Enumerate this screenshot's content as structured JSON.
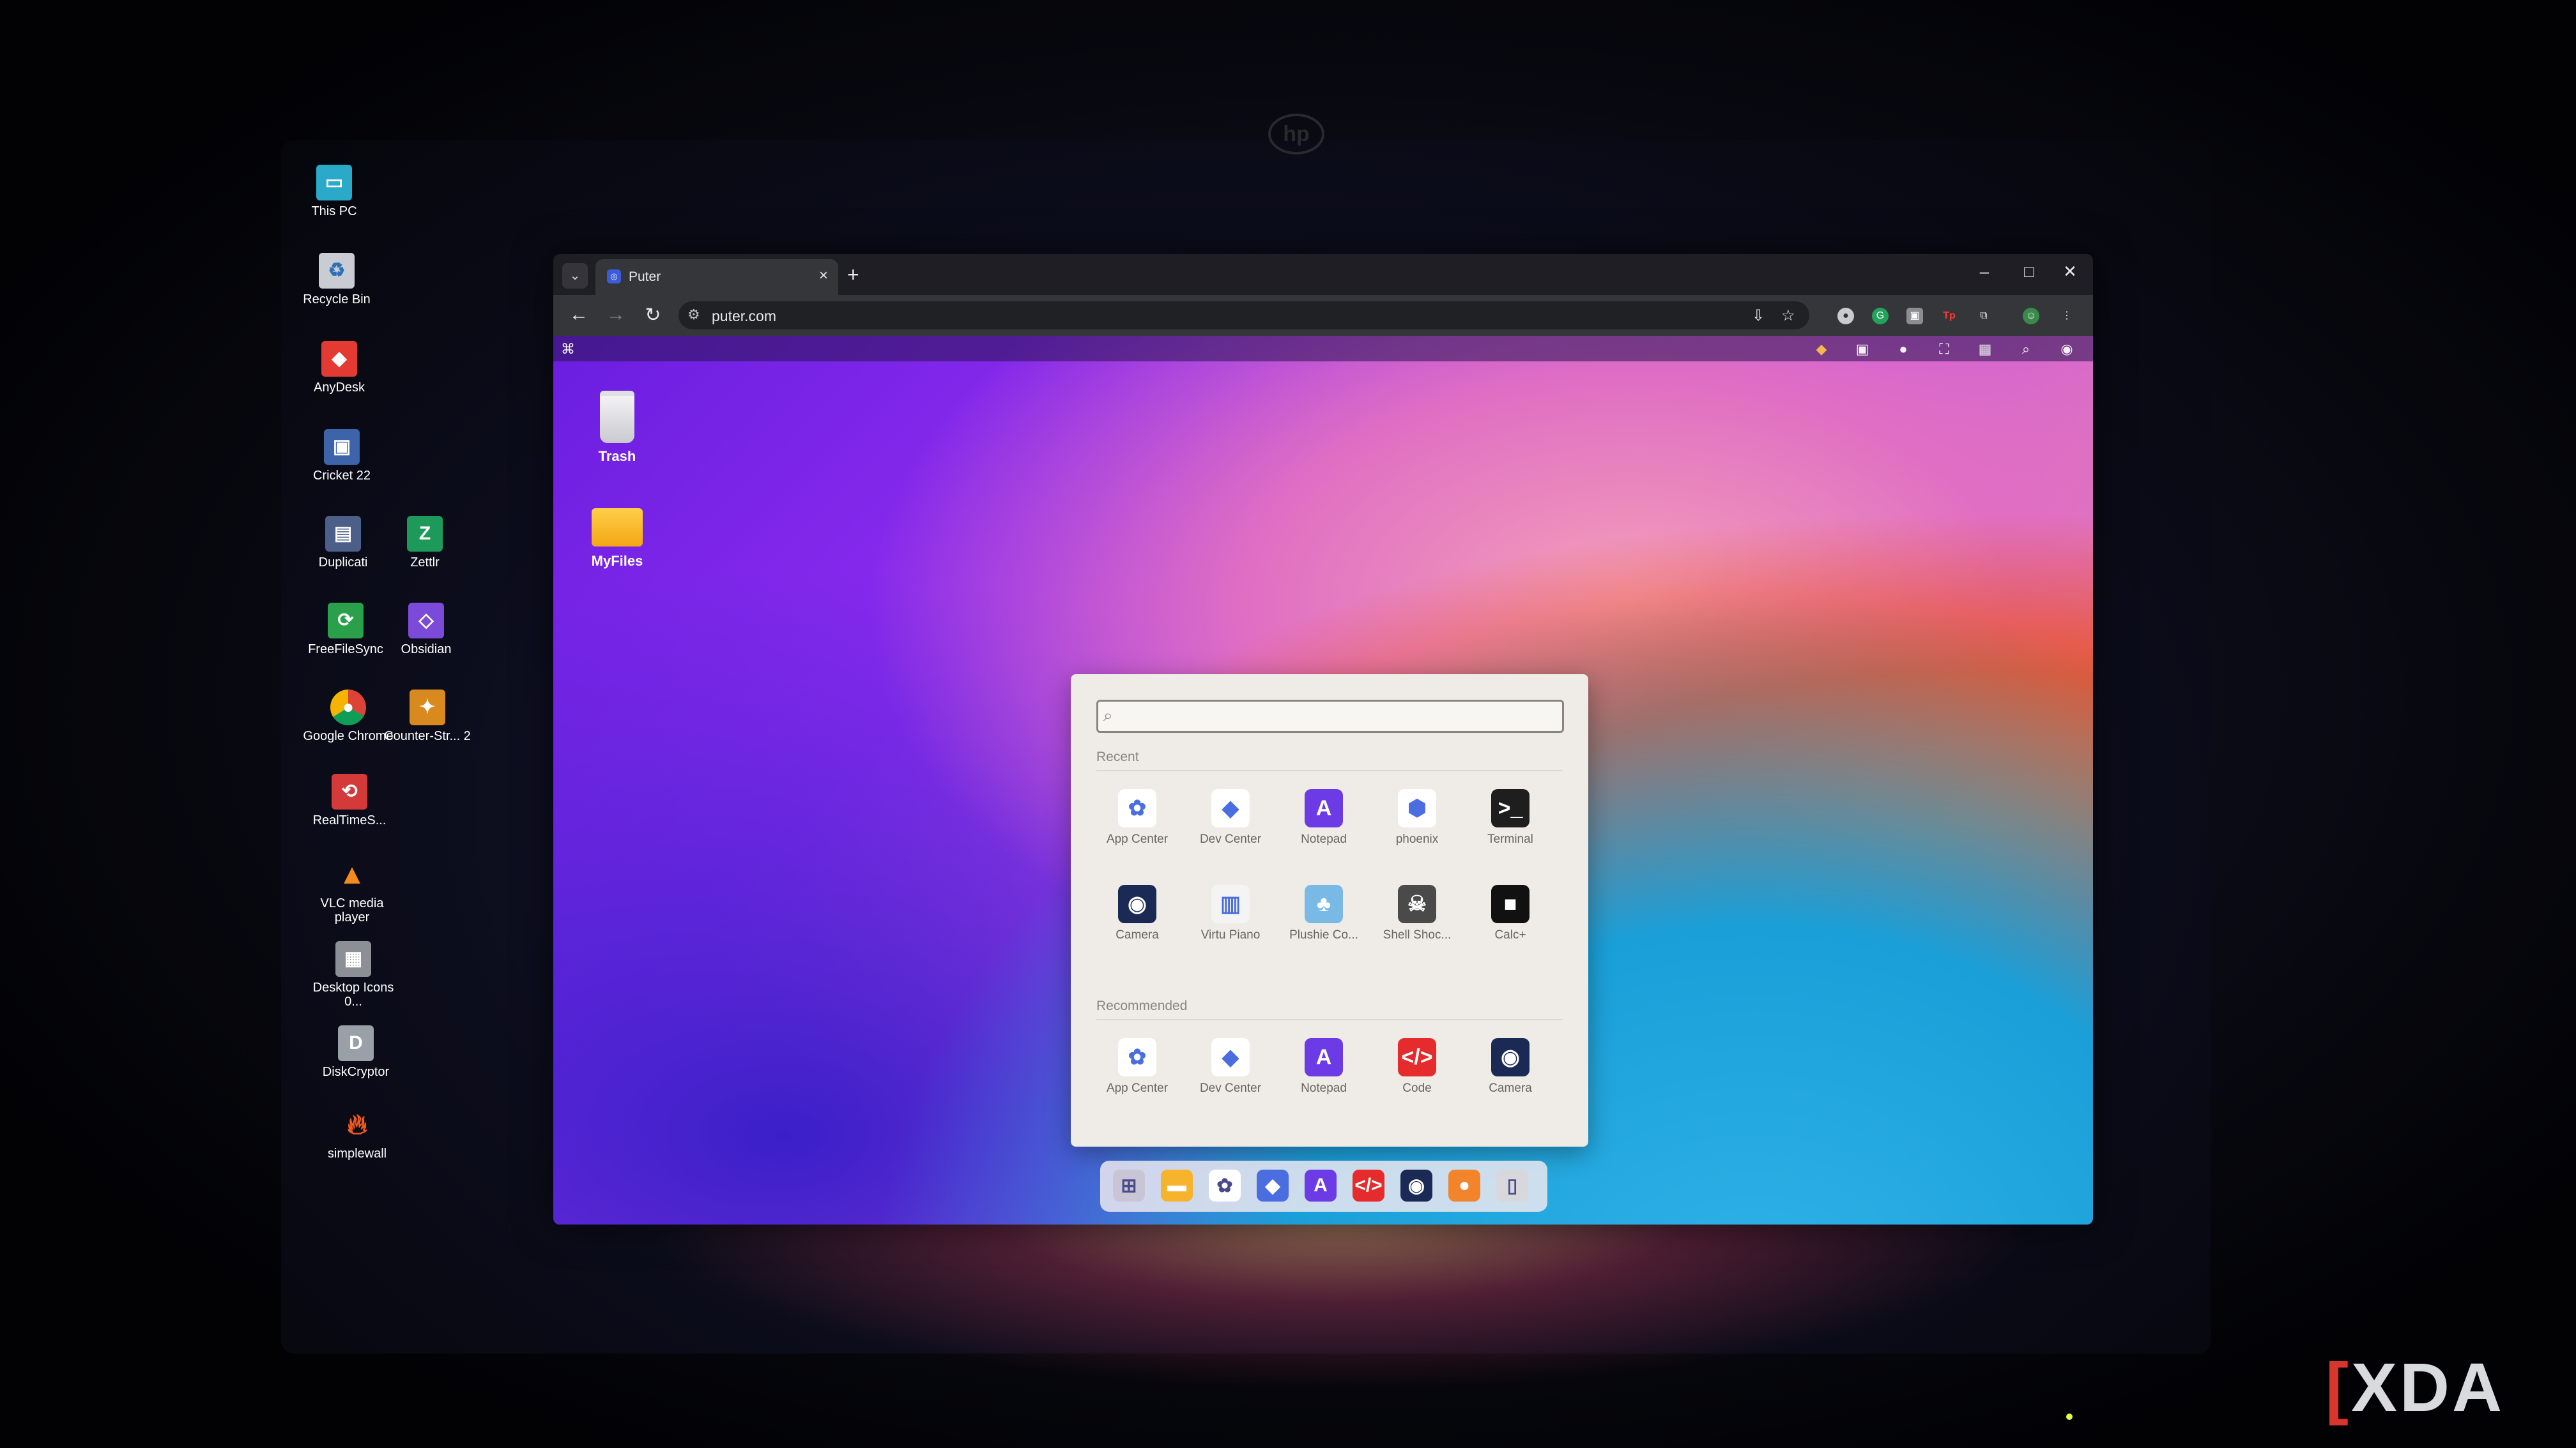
{
  "desktop": {
    "icons": [
      {
        "label": "This PC",
        "icon": "monitor-icon"
      },
      {
        "label": "Recycle Bin",
        "icon": "recycle-bin-icon"
      },
      {
        "label": "AnyDesk",
        "icon": "anydesk-icon"
      },
      {
        "label": "Cricket 22",
        "icon": "cricket-icon"
      },
      {
        "label": "Duplicati",
        "icon": "duplicati-icon"
      },
      {
        "label": "Zettlr",
        "icon": "zettlr-icon"
      },
      {
        "label": "FreeFileSync",
        "icon": "freefilesync-icon"
      },
      {
        "label": "Obsidian",
        "icon": "obsidian-icon"
      },
      {
        "label": "Google Chrome",
        "icon": "chrome-icon"
      },
      {
        "label": "Counter-Str... 2",
        "icon": "counter-strike-icon"
      },
      {
        "label": "RealTimeS...",
        "icon": "realtimesync-icon"
      },
      {
        "label": "VLC media player",
        "icon": "vlc-icon"
      },
      {
        "label": "Desktop Icons 0...",
        "icon": "desktop-icons-icon"
      },
      {
        "label": "DiskCryptor",
        "icon": "diskcryptor-icon"
      },
      {
        "label": "simplewall",
        "icon": "simplewall-icon"
      }
    ]
  },
  "browser": {
    "tab_title": "Puter",
    "tab_close": "×",
    "new_tab": "+",
    "url": "puter.com",
    "window_controls": {
      "minimize": "–",
      "maximize": "□",
      "close": "✕"
    }
  },
  "puter": {
    "desktop_items": [
      {
        "label": "Trash",
        "icon": "trash-icon"
      },
      {
        "label": "MyFiles",
        "icon": "folder-icon"
      }
    ],
    "start_menu": {
      "search_placeholder": "",
      "recent_label": "Recent",
      "recommended_label": "Recommended",
      "recent": [
        {
          "label": "App Center",
          "icon": "app-center-icon",
          "glyph": "✿",
          "color": "#ffffff"
        },
        {
          "label": "Dev Center",
          "icon": "dev-center-icon",
          "glyph": "◆",
          "color": "#ffffff"
        },
        {
          "label": "Notepad",
          "icon": "notepad-icon",
          "glyph": "A",
          "color": "#6c3be6"
        },
        {
          "label": "phoenix",
          "icon": "phoenix-icon",
          "glyph": "⬢",
          "color": "#ffffff"
        },
        {
          "label": "Terminal",
          "icon": "terminal-icon",
          "glyph": ">_",
          "color": "#1e1e1e"
        },
        {
          "label": "Camera",
          "icon": "camera-icon",
          "glyph": "◉",
          "color": "#1b2a55"
        },
        {
          "label": "Virtu Piano",
          "icon": "piano-icon",
          "glyph": "▥",
          "color": "#f4f4f4"
        },
        {
          "label": "Plushie Co...",
          "icon": "plushie-icon",
          "glyph": "♣",
          "color": "#79b9e6"
        },
        {
          "label": "Shell Shoc...",
          "icon": "shell-shock-icon",
          "glyph": "☠",
          "color": "#4a4a4a"
        },
        {
          "label": "Calc+",
          "icon": "calc-icon",
          "glyph": "■",
          "color": "#111111"
        }
      ],
      "recommended": [
        {
          "label": "App Center",
          "icon": "app-center-icon",
          "glyph": "✿",
          "color": "#ffffff"
        },
        {
          "label": "Dev Center",
          "icon": "dev-center-icon",
          "glyph": "◆",
          "color": "#ffffff"
        },
        {
          "label": "Notepad",
          "icon": "notepad-icon",
          "glyph": "A",
          "color": "#6c3be6"
        },
        {
          "label": "Code",
          "icon": "code-icon",
          "glyph": "</>",
          "color": "#e52b2b"
        },
        {
          "label": "Camera",
          "icon": "camera-icon",
          "glyph": "◉",
          "color": "#1b2a55"
        }
      ]
    },
    "taskbar": [
      {
        "name": "start-menu-icon",
        "glyph": "⊞",
        "color": "#c8c6d4"
      },
      {
        "name": "folder-icon",
        "glyph": "▬",
        "color": "#f6b32b"
      },
      {
        "name": "app-center-icon",
        "glyph": "✿",
        "color": "#ffffff"
      },
      {
        "name": "dev-center-icon",
        "glyph": "◆",
        "color": "#4a6ee0"
      },
      {
        "name": "notepad-icon",
        "glyph": "A",
        "color": "#6c3be6"
      },
      {
        "name": "code-icon",
        "glyph": "</>",
        "color": "#e52b2b"
      },
      {
        "name": "camera-icon",
        "glyph": "◉",
        "color": "#1b2a55"
      },
      {
        "name": "recorder-icon",
        "glyph": "●",
        "color": "#f2842b"
      },
      {
        "name": "trash-icon",
        "glyph": "▯",
        "color": "#d8d8dc"
      }
    ]
  },
  "watermark": {
    "text": "XDA"
  }
}
